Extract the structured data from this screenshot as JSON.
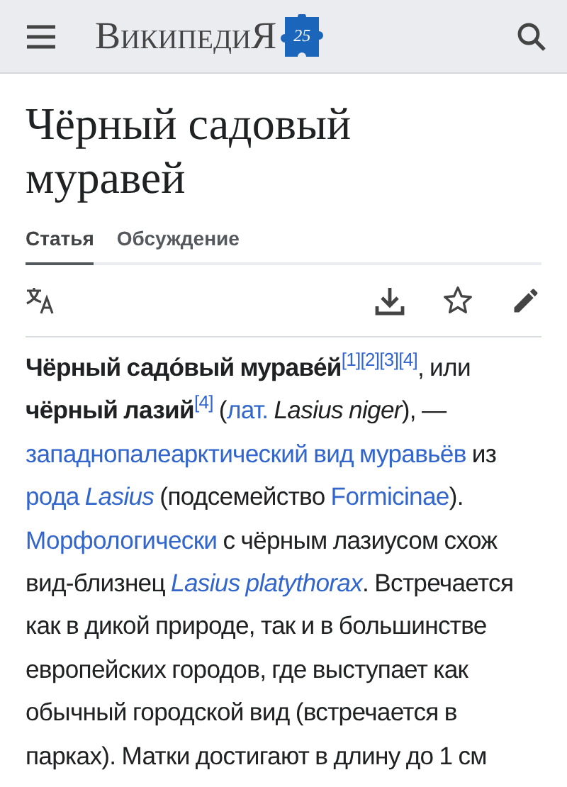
{
  "header": {
    "logo_text": "ВикипедиЯ",
    "badge_text": "25"
  },
  "title": "Чёрный садовый муравей",
  "tabs": [
    {
      "label": "Статья",
      "selected": true
    },
    {
      "label": "Обсуждение",
      "selected": false
    }
  ],
  "paragraph": [
    {
      "kind": "bold",
      "text": "Чёрный садо́вый мураве́й"
    },
    {
      "kind": "ref",
      "text": "[1]"
    },
    {
      "kind": "ref",
      "text": "[2]"
    },
    {
      "kind": "ref",
      "text": "[3]"
    },
    {
      "kind": "ref",
      "text": "[4]"
    },
    {
      "kind": "text",
      "text": ", или "
    },
    {
      "kind": "bold",
      "text": "чёрный лазий"
    },
    {
      "kind": "ref",
      "text": "[4]"
    },
    {
      "kind": "text",
      "text": " ("
    },
    {
      "kind": "link",
      "text": "лат."
    },
    {
      "kind": "text",
      "text": " *Lasius niger*), — "
    },
    {
      "kind": "link",
      "text": "западнопалеарктический вид муравьёв"
    },
    {
      "kind": "text",
      "text": " из "
    },
    {
      "kind": "link",
      "text": "рода *Lasius*"
    },
    {
      "kind": "text",
      "text": " (подсемейство "
    },
    {
      "kind": "link",
      "text": "Formicinae"
    },
    {
      "kind": "text",
      "text": "). "
    },
    {
      "kind": "link",
      "text": "Морфологически"
    },
    {
      "kind": "text",
      "text": " с чёрным лазиусом схож вид-близнец "
    },
    {
      "kind": "link",
      "text": "*Lasius platythorax*"
    },
    {
      "kind": "text",
      "text": ". Встречается как в дикой природе, так и в большинстве европейских городов, где выступает как обычный городской вид (встречается в парках). Матки достигают в длину до 1 см"
    }
  ]
}
